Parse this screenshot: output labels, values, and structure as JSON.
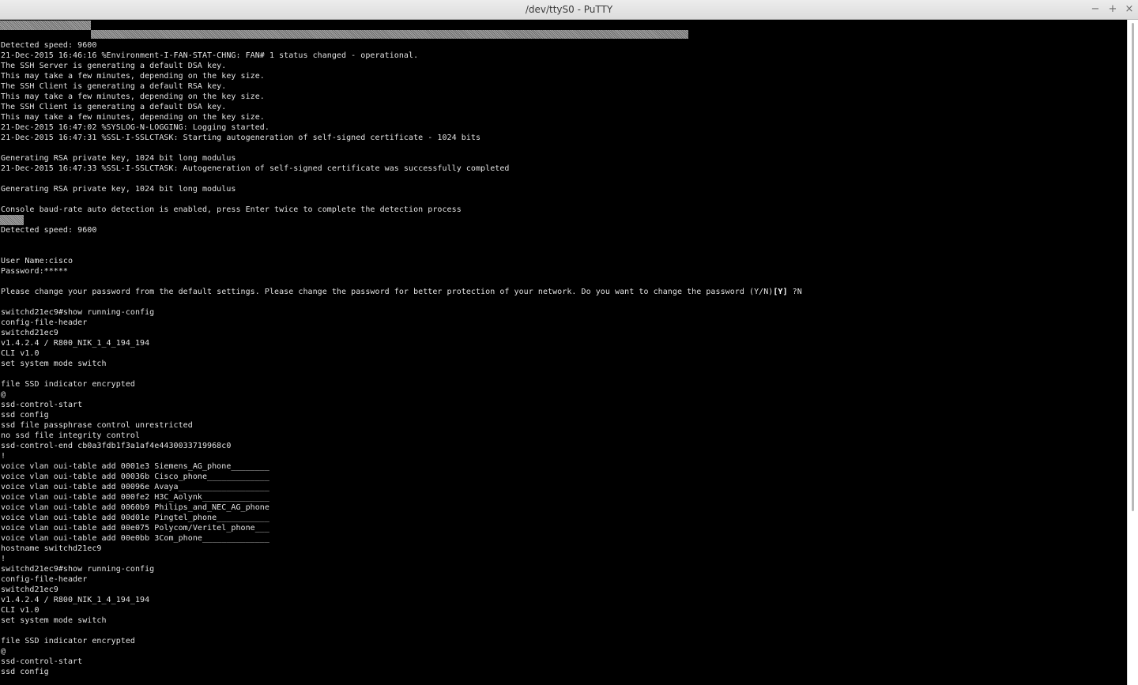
{
  "window": {
    "title": "/dev/ttyS0 - PuTTY",
    "controls": {
      "minimize": "−",
      "maximize": "+",
      "close": "×"
    }
  },
  "terminal": {
    "line_00": "",
    "line_01": "",
    "line_02": "Detected speed: 9600",
    "line_03": "21-Dec-2015 16:46:16 %Environment-I-FAN-STAT-CHNG: FAN# 1 status changed - operational.",
    "line_04": "The SSH Server is generating a default DSA key.",
    "line_05": "This may take a few minutes, depending on the key size.",
    "line_06": "The SSH Client is generating a default RSA key.",
    "line_07": "This may take a few minutes, depending on the key size.",
    "line_08": "The SSH Client is generating a default DSA key.",
    "line_09": "This may take a few minutes, depending on the key size.",
    "line_10": "21-Dec-2015 16:47:02 %SYSLOG-N-LOGGING: Logging started.",
    "line_11": "21-Dec-2015 16:47:31 %SSL-I-SSLCTASK: Starting autogeneration of self-signed certificate - 1024 bits",
    "line_12": "",
    "line_13": "Generating RSA private key, 1024 bit long modulus",
    "line_14": "21-Dec-2015 16:47:33 %SSL-I-SSLCTASK: Autogeneration of self-signed certificate was successfully completed",
    "line_15": "",
    "line_16": "Generating RSA private key, 1024 bit long modulus",
    "line_17": "",
    "line_18": "Console baud-rate auto detection is enabled, press Enter twice to complete the detection process",
    "line_19": "",
    "line_20": "Detected speed: 9600",
    "line_21": "",
    "line_22": "",
    "line_23": "User Name:cisco",
    "line_24": "Password:*****",
    "line_25": "",
    "line_26_pre": "Please change your password from the default settings. Please change the password for better protection of your network. Do you want to change the password (Y/N)",
    "line_26_bold": "[Y]",
    "line_26_post": " ?N",
    "line_27": "",
    "line_28": "switchd21ec9#show running-config",
    "line_29": "config-file-header",
    "line_30": "switchd21ec9",
    "line_31": "v1.4.2.4 / R800_NIK_1_4_194_194",
    "line_32": "CLI v1.0",
    "line_33": "set system mode switch",
    "line_34": "",
    "line_35": "file SSD indicator encrypted",
    "line_36": "@",
    "line_37": "ssd-control-start",
    "line_38": "ssd config",
    "line_39": "ssd file passphrase control unrestricted",
    "line_40": "no ssd file integrity control",
    "line_41": "ssd-control-end cb0a3fdb1f3a1af4e4430033719968c0",
    "line_42": "!",
    "line_43": "voice vlan oui-table add 0001e3 Siemens_AG_phone________",
    "line_44": "voice vlan oui-table add 00036b Cisco_phone_____________",
    "line_45": "voice vlan oui-table add 00096e Avaya___________________",
    "line_46": "voice vlan oui-table add 000fe2 H3C_Aolynk______________",
    "line_47": "voice vlan oui-table add 0060b9 Philips_and_NEC_AG_phone",
    "line_48": "voice vlan oui-table add 00d01e Pingtel_phone___________",
    "line_49": "voice vlan oui-table add 00e075 Polycom/Veritel_phone___",
    "line_50": "voice vlan oui-table add 00e0bb 3Com_phone______________",
    "line_51": "hostname switchd21ec9",
    "line_52": "!",
    "line_53": "switchd21ec9#show running-config",
    "line_54": "config-file-header",
    "line_55": "switchd21ec9",
    "line_56": "v1.4.2.4 / R800_NIK_1_4_194_194",
    "line_57": "CLI v1.0",
    "line_58": "set system mode switch",
    "line_59": "",
    "line_60": "file SSD indicator encrypted",
    "line_61": "@",
    "line_62": "ssd-control-start",
    "line_63": "ssd config"
  },
  "colors": {
    "terminal_bg": "#000000",
    "terminal_fg": "#e2e2e2",
    "titlebar_bg": "#e4e4e4",
    "scrollbar_thumb": "#b9b9b9"
  }
}
